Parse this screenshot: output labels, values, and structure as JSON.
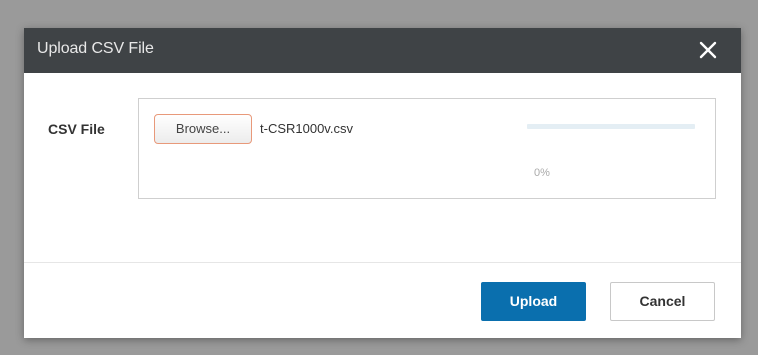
{
  "dialog": {
    "title": "Upload CSV File",
    "close_icon": "close-icon"
  },
  "form": {
    "label": "CSV File",
    "browse_label": "Browse...",
    "filename": "t-CSR1000v.csv",
    "progress_percent": 0,
    "progress_text": "0%"
  },
  "footer": {
    "upload_label": "Upload",
    "cancel_label": "Cancel"
  },
  "colors": {
    "titlebar": "#3f4346",
    "primary": "#0a6fae",
    "browse_border": "#e8997a"
  }
}
